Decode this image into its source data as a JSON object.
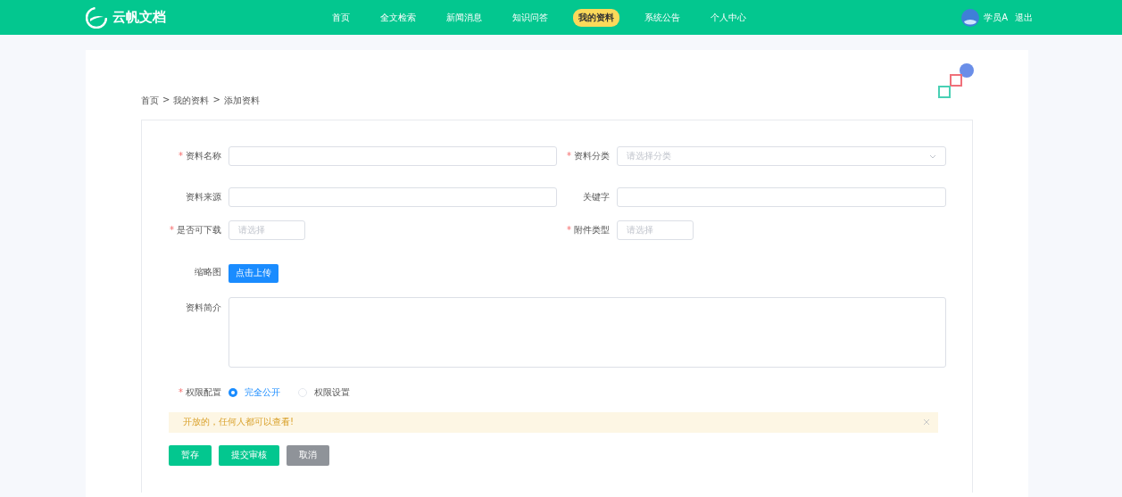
{
  "header": {
    "brand": "云帆文档",
    "nav": [
      {
        "label": "首页",
        "selected": false
      },
      {
        "label": "全文检索",
        "selected": false
      },
      {
        "label": "新闻消息",
        "selected": false
      },
      {
        "label": "知识问答",
        "selected": false
      },
      {
        "label": "我的资料",
        "selected": true
      },
      {
        "label": "系统公告",
        "selected": false
      },
      {
        "label": "个人中心",
        "selected": false
      }
    ],
    "user": "学员A",
    "logout": "退出"
  },
  "breadcrumb": {
    "items": [
      "首页",
      "我的资料",
      "添加资料"
    ],
    "separator": ">"
  },
  "form": {
    "rows": [
      [
        {
          "label": "资料名称",
          "mark": "*",
          "kind": "input"
        },
        {
          "label": "资料分类",
          "mark": "*",
          "kind": "select",
          "placeholder": "请选择分类"
        }
      ],
      [
        {
          "label": "资料来源",
          "kind": "input"
        },
        {
          "label": "关键字",
          "kind": "input"
        }
      ],
      [
        {
          "label": "是否可下载",
          "mark": "*",
          "kind": "small-select",
          "placeholder": "请选择"
        },
        {
          "label": "附件类型",
          "mark": "*",
          "kind": "small-select",
          "placeholder": "请选择"
        }
      ]
    ],
    "thumbnail": {
      "label": "缩略图",
      "button": "点击上传"
    },
    "intro": {
      "label": "资料简介"
    },
    "permission": {
      "label": "权限配置",
      "mark": "*",
      "options": [
        {
          "label": "完全公开",
          "selected": true
        },
        {
          "label": "权限设置",
          "selected": false
        }
      ]
    },
    "alert": {
      "text": "开放的，任何人都可以查看!"
    },
    "buttons": [
      {
        "label": "暂存",
        "kind": "primary"
      },
      {
        "label": "提交审核",
        "kind": "primary"
      },
      {
        "label": "取消",
        "kind": "neutral"
      }
    ]
  }
}
